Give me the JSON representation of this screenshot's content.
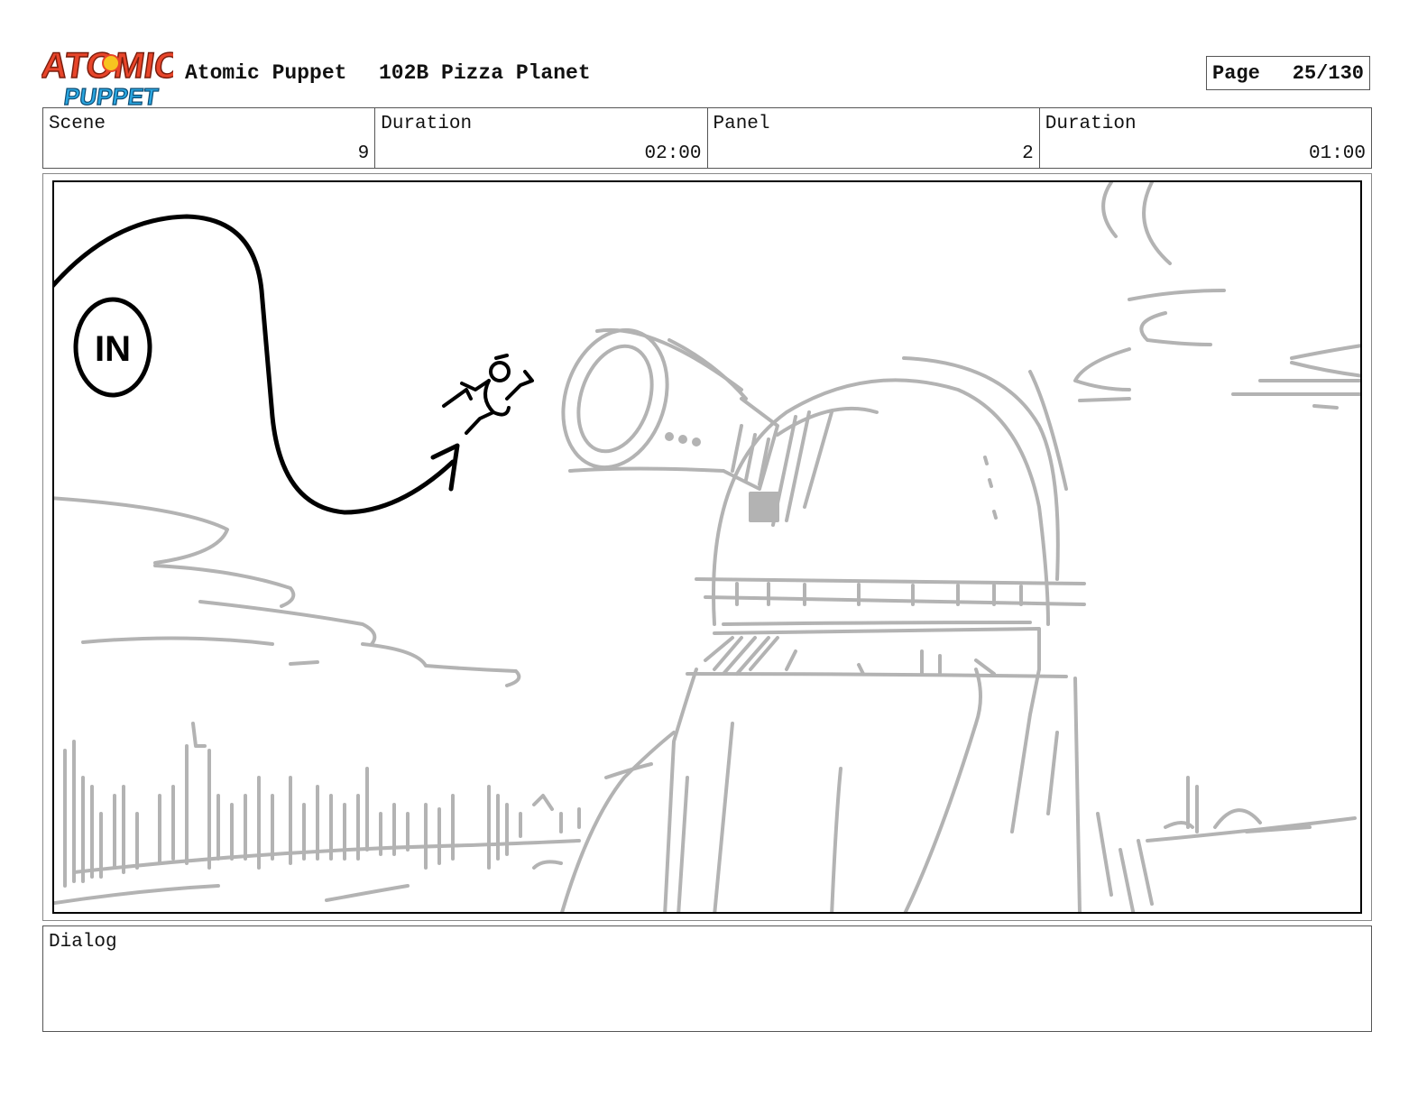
{
  "header": {
    "logo_text": "ATOMIC PUPPET",
    "show_title": "Atomic Puppet",
    "episode_title": "102B Pizza Planet",
    "page_label": "Page",
    "page_number": "25/130"
  },
  "info": {
    "scene_label": "Scene",
    "scene_value": "9",
    "scene_duration_label": "Duration",
    "scene_duration_value": "02:00",
    "panel_label": "Panel",
    "panel_value": "2",
    "panel_duration_label": "Duration",
    "panel_duration_value": "01:00"
  },
  "panel": {
    "in_marker": "IN"
  },
  "dialog": {
    "label": "Dialog",
    "text": ""
  },
  "colors": {
    "sketch_gray": "#b3b3b3",
    "ink_black": "#000000",
    "logo_red": "#e8452a",
    "logo_blue": "#2aa6e0",
    "logo_yellow": "#f7c320"
  }
}
